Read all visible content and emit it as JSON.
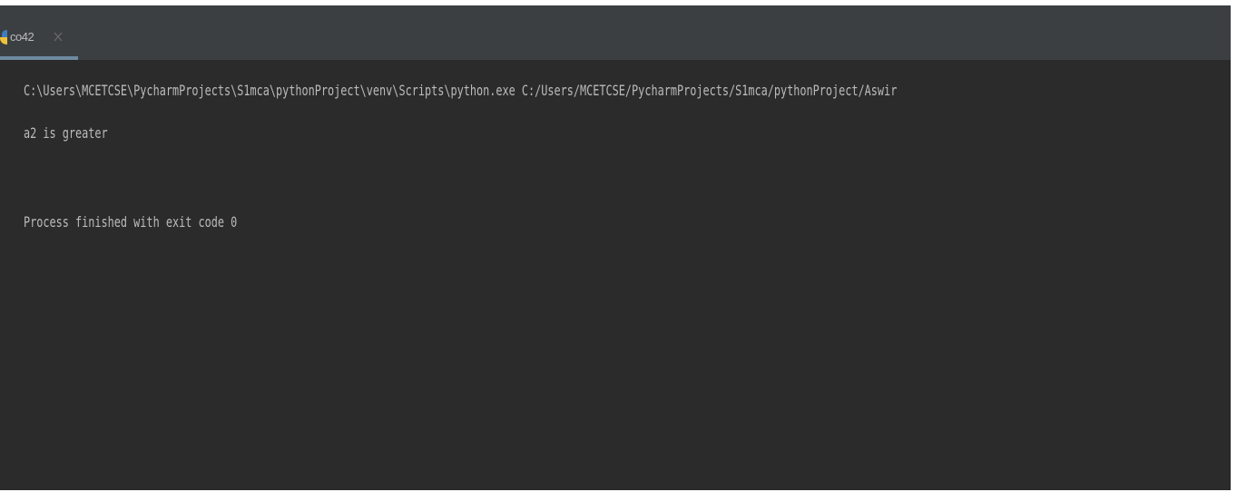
{
  "tab": {
    "label": "co42",
    "icon": "python-file-icon",
    "close_icon": "close-icon"
  },
  "console": {
    "command_line": "C:\\Users\\MCETCSE\\PycharmProjects\\S1mca\\pythonProject\\venv\\Scripts\\python.exe C:/Users/MCETCSE/PycharmProjects/S1mca/pythonProject/Aswir",
    "output_line": "a2 is greater",
    "exit_line": "Process finished with exit code 0"
  },
  "colors": {
    "console_background": "#2b2b2b",
    "tabbar_background": "#3c3f41",
    "text": "#bbbbbb",
    "tab_underline": "#6e8aa0"
  }
}
